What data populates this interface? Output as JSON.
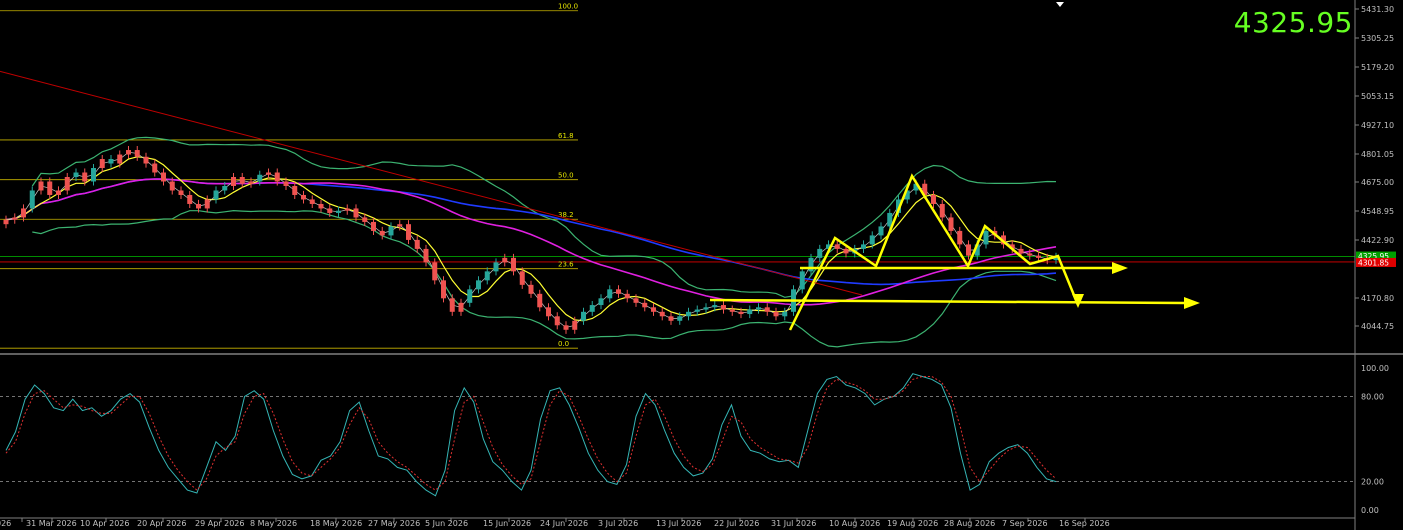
{
  "symbol_price": "4325.95",
  "colors": {
    "background": "#000000",
    "bull_candle": "#26a69a",
    "bear_candle": "#ef5350",
    "bollinger": "#3cb371",
    "ma_fast": "#ffff33",
    "ma_mid": "#c8c8c8",
    "ma_slow_blue": "#1f3bff",
    "ma_magenta": "#e020e0",
    "trend_red": "#c00000",
    "fib": "#c8b400",
    "annotation": "#ffff00",
    "osc_main": "#35b5b5",
    "osc_signal": "#e03030",
    "current_price": "#00a000",
    "bid_price": "#e00000"
  },
  "price_axis": {
    "labels": [
      "5431.30",
      "5305.25",
      "5179.20",
      "5053.15",
      "4927.10",
      "4801.05",
      "4675.00",
      "4548.95",
      "4422.90",
      "4170.80",
      "4044.75"
    ],
    "current_label": "4325.95",
    "bid_label": "4301.85"
  },
  "osc_axis": {
    "labels": [
      "100.00",
      "80.00",
      "20.00",
      "0.00"
    ]
  },
  "time_axis": {
    "labels": [
      "026",
      "31 Mar 2026",
      "10 Apr 2026",
      "20 Apr 2026",
      "29 Apr 2026",
      "8 May 2026",
      "18 May 2026",
      "27 May 2026",
      "5 Jun 2026",
      "15 Jun 2026",
      "24 Jun 2026",
      "3 Jul 2026",
      "13 Jul 2026",
      "22 Jul 2026",
      "31 Jul 2026",
      "10 Aug 2026",
      "19 Aug 2026",
      "28 Aug 2026",
      "7 Sep 2026",
      "16 Sep 2026"
    ]
  },
  "fibonacci": {
    "levels": [
      {
        "label": "100.0",
        "price": 5420
      },
      {
        "label": "61.8",
        "price": 4845
      },
      {
        "label": "50.0",
        "price": 4668
      },
      {
        "label": "38.2",
        "price": 4492
      },
      {
        "label": "23.6",
        "price": 4272
      },
      {
        "label": "0.0",
        "price": 3918
      }
    ]
  },
  "chart_data": {
    "type": "candlestick",
    "title": "",
    "price_range": [
      3910,
      5450
    ],
    "oscillator_range": [
      0,
      100
    ],
    "close": [
      4490,
      4500,
      4540,
      4620,
      4660,
      4600,
      4620,
      4680,
      4700,
      4660,
      4720,
      4760,
      4740,
      4780,
      4800,
      4770,
      4740,
      4700,
      4660,
      4620,
      4600,
      4560,
      4540,
      4580,
      4620,
      4640,
      4680,
      4650,
      4660,
      4690,
      4700,
      4660,
      4640,
      4600,
      4580,
      4560,
      4540,
      4520,
      4530,
      4540,
      4500,
      4480,
      4440,
      4420,
      4460,
      4470,
      4400,
      4360,
      4300,
      4220,
      4140,
      4080,
      4120,
      4180,
      4220,
      4260,
      4300,
      4320,
      4260,
      4200,
      4160,
      4100,
      4060,
      4020,
      4000,
      4040,
      4080,
      4110,
      4140,
      4180,
      4160,
      4140,
      4120,
      4100,
      4080,
      4060,
      4040,
      4060,
      4080,
      4090,
      4100,
      4110,
      4090,
      4080,
      4070,
      4090,
      4100,
      4080,
      4060,
      4080,
      4180,
      4260,
      4320,
      4360,
      4380,
      4360,
      4340,
      4360,
      4380,
      4420,
      4460,
      4520,
      4580,
      4620,
      4650,
      4600,
      4560,
      4500,
      4440,
      4380,
      4330,
      4380,
      4440,
      4420,
      4380,
      4360,
      4340,
      4330,
      4320,
      4310,
      4325
    ],
    "bull_candles": [
      3,
      8,
      10,
      12,
      24,
      25,
      29,
      38,
      44,
      53,
      54,
      55,
      56,
      66,
      67,
      68,
      69,
      77,
      78,
      79,
      80,
      81,
      85,
      86,
      89,
      90,
      91,
      92,
      93,
      94,
      97,
      98,
      99,
      100,
      101,
      102,
      103,
      104,
      111,
      112,
      120
    ],
    "oscillator_main": [
      42,
      55,
      78,
      88,
      82,
      72,
      70,
      78,
      70,
      72,
      66,
      70,
      78,
      82,
      76,
      58,
      42,
      30,
      22,
      14,
      12,
      30,
      48,
      42,
      52,
      80,
      84,
      78,
      56,
      38,
      25,
      22,
      24,
      35,
      38,
      48,
      70,
      76,
      56,
      38,
      36,
      30,
      28,
      20,
      14,
      10,
      28,
      70,
      86,
      76,
      50,
      34,
      28,
      20,
      14,
      28,
      64,
      84,
      86,
      74,
      58,
      40,
      28,
      20,
      18,
      32,
      66,
      82,
      74,
      56,
      40,
      30,
      24,
      26,
      36,
      60,
      74,
      52,
      42,
      40,
      36,
      34,
      35,
      30,
      56,
      82,
      92,
      94,
      88,
      86,
      82,
      74,
      78,
      80,
      86,
      96,
      94,
      92,
      88,
      72,
      40,
      14,
      18,
      34,
      40,
      44,
      46,
      40,
      30,
      22,
      20
    ],
    "oscillator_signal": [
      40,
      48,
      68,
      82,
      84,
      78,
      72,
      74,
      73,
      70,
      68,
      68,
      74,
      80,
      80,
      68,
      52,
      38,
      28,
      20,
      14,
      22,
      38,
      44,
      48,
      68,
      80,
      82,
      68,
      50,
      34,
      26,
      24,
      30,
      36,
      44,
      60,
      72,
      64,
      48,
      40,
      34,
      30,
      24,
      18,
      14,
      20,
      50,
      76,
      80,
      62,
      44,
      32,
      24,
      18,
      22,
      48,
      74,
      84,
      80,
      66,
      50,
      36,
      26,
      20,
      26,
      52,
      74,
      78,
      66,
      50,
      38,
      30,
      27,
      32,
      48,
      66,
      62,
      50,
      44,
      40,
      36,
      35,
      33,
      44,
      68,
      86,
      92,
      90,
      88,
      84,
      78,
      78,
      80,
      84,
      92,
      94,
      94,
      90,
      80,
      58,
      30,
      20,
      28,
      36,
      42,
      45,
      44,
      36,
      28,
      22
    ]
  }
}
